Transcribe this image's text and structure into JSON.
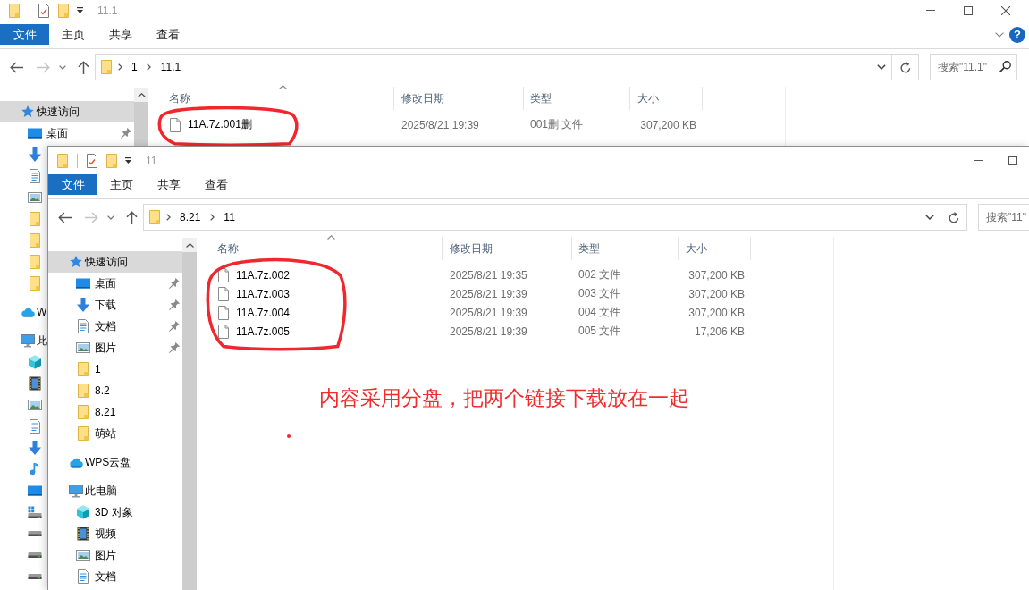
{
  "windows": [
    {
      "title": "11.1",
      "toolbar_separators": false,
      "caption_buttons": [
        {
          "kind": "minimize"
        },
        {
          "kind": "maximize"
        },
        {
          "kind": "close"
        }
      ],
      "ribbon_tabs": [
        {
          "kind": "file",
          "label": "文件"
        },
        {
          "kind": "tab",
          "label": "主页"
        },
        {
          "kind": "tab",
          "label": "共享"
        },
        {
          "kind": "tab",
          "label": "查看"
        }
      ],
      "help": "?",
      "nav_buttons": [
        {
          "kind": "back",
          "disabled": false
        },
        {
          "kind": "forward",
          "disabled": true
        },
        {
          "kind": "recent",
          "disabled": false
        },
        {
          "kind": "up",
          "disabled": false
        }
      ],
      "path": [
        "1",
        "11.1"
      ],
      "search": {
        "placeholder": "搜索\"11.1\""
      },
      "sidebar": [
        {
          "kind": "star",
          "label": "快速访问",
          "selected": true,
          "children": [
            {
              "kind": "desktop",
              "label": "桌面",
              "selected": false,
              "pinned": true
            },
            {
              "kind": "download",
              "selected": false
            },
            {
              "kind": "document",
              "selected": false
            },
            {
              "kind": "picture",
              "selected": false
            },
            {
              "kind": "folder",
              "selected": false
            },
            {
              "kind": "folder",
              "selected": false
            },
            {
              "kind": "folder",
              "selected": false
            },
            {
              "kind": "folder",
              "selected": false
            }
          ]
        },
        {
          "kind": "cloud",
          "label": "W",
          "selected": false
        },
        {
          "kind": "computer",
          "label": "此",
          "selected": false,
          "children": [
            {
              "kind": "cube",
              "selected": false
            },
            {
              "kind": "video",
              "selected": false
            },
            {
              "kind": "picture",
              "selected": false
            },
            {
              "kind": "document",
              "selected": false
            },
            {
              "kind": "download",
              "selected": false
            },
            {
              "kind": "music",
              "selected": false
            },
            {
              "kind": "desktop",
              "selected": false
            },
            {
              "kind": "system_drive",
              "selected": false
            },
            {
              "kind": "drive",
              "selected": false
            },
            {
              "kind": "drive",
              "selected": false
            },
            {
              "kind": "drive",
              "selected": false
            }
          ]
        }
      ],
      "columns": [
        "名称",
        "修改日期",
        "类型",
        "大小"
      ],
      "files": [
        {
          "name": "11A.7z.001删",
          "modified": "2025/8/21 19:39",
          "type": "001删 文件",
          "size": "307,200 KB"
        }
      ],
      "circled": true
    },
    {
      "title": "11",
      "toolbar_separators": true,
      "clipped_right": true,
      "caption_buttons": [
        {
          "kind": "minimize"
        },
        {
          "kind": "maximize"
        }
      ],
      "ribbon_tabs": [
        {
          "kind": "file",
          "label": "文件"
        },
        {
          "kind": "tab",
          "label": "主页"
        },
        {
          "kind": "tab",
          "label": "共享"
        },
        {
          "kind": "tab",
          "label": "查看"
        }
      ],
      "nav_buttons": [
        {
          "kind": "back",
          "disabled": false
        },
        {
          "kind": "forward",
          "disabled": true
        },
        {
          "kind": "recent",
          "disabled": false
        },
        {
          "kind": "up",
          "disabled": false
        }
      ],
      "path": [
        "8.21",
        "11"
      ],
      "search": {
        "placeholder": "搜索\"11\""
      },
      "sidebar": [
        {
          "kind": "star",
          "label": "快速访问",
          "selected": true,
          "children": [
            {
              "kind": "desktop",
              "label": "桌面",
              "selected": false,
              "pinned": true
            },
            {
              "kind": "download",
              "label": "下载",
              "selected": false,
              "pinned": true
            },
            {
              "kind": "document",
              "label": "文档",
              "selected": false,
              "pinned": true
            },
            {
              "kind": "picture",
              "label": "图片",
              "selected": false,
              "pinned": true
            },
            {
              "kind": "folder",
              "label": "1",
              "selected": false,
              "pinned": false
            },
            {
              "kind": "folder",
              "label": "8.2",
              "selected": false,
              "pinned": false
            },
            {
              "kind": "folder",
              "label": "8.21",
              "selected": false,
              "pinned": false
            },
            {
              "kind": "folder",
              "label": "萌站",
              "selected": false,
              "pinned": false
            }
          ]
        },
        {
          "kind": "cloud",
          "label": "WPS云盘",
          "selected": false
        },
        {
          "kind": "computer",
          "label": "此电脑",
          "selected": false,
          "children": [
            {
              "kind": "cube",
              "label": "3D 对象",
              "selected": false
            },
            {
              "kind": "video",
              "label": "视频",
              "selected": false
            },
            {
              "kind": "picture",
              "label": "图片",
              "selected": false
            },
            {
              "kind": "document",
              "label": "文档",
              "selected": false
            }
          ]
        }
      ],
      "columns": [
        "名称",
        "修改日期",
        "类型",
        "大小"
      ],
      "files": [
        {
          "name": "11A.7z.002",
          "modified": "2025/8/21 19:35",
          "type": "002 文件",
          "size": "307,200 KB"
        },
        {
          "name": "11A.7z.003",
          "modified": "2025/8/21 19:39",
          "type": "003 文件",
          "size": "307,200 KB"
        },
        {
          "name": "11A.7z.004",
          "modified": "2025/8/21 19:39",
          "type": "004 文件",
          "size": "307,200 KB"
        },
        {
          "name": "11A.7z.005",
          "modified": "2025/8/21 19:39",
          "type": "005 文件",
          "size": "17,206 KB"
        }
      ],
      "circled": true
    }
  ],
  "annotation": "内容采用分盘，把两个链接下载放在一起"
}
